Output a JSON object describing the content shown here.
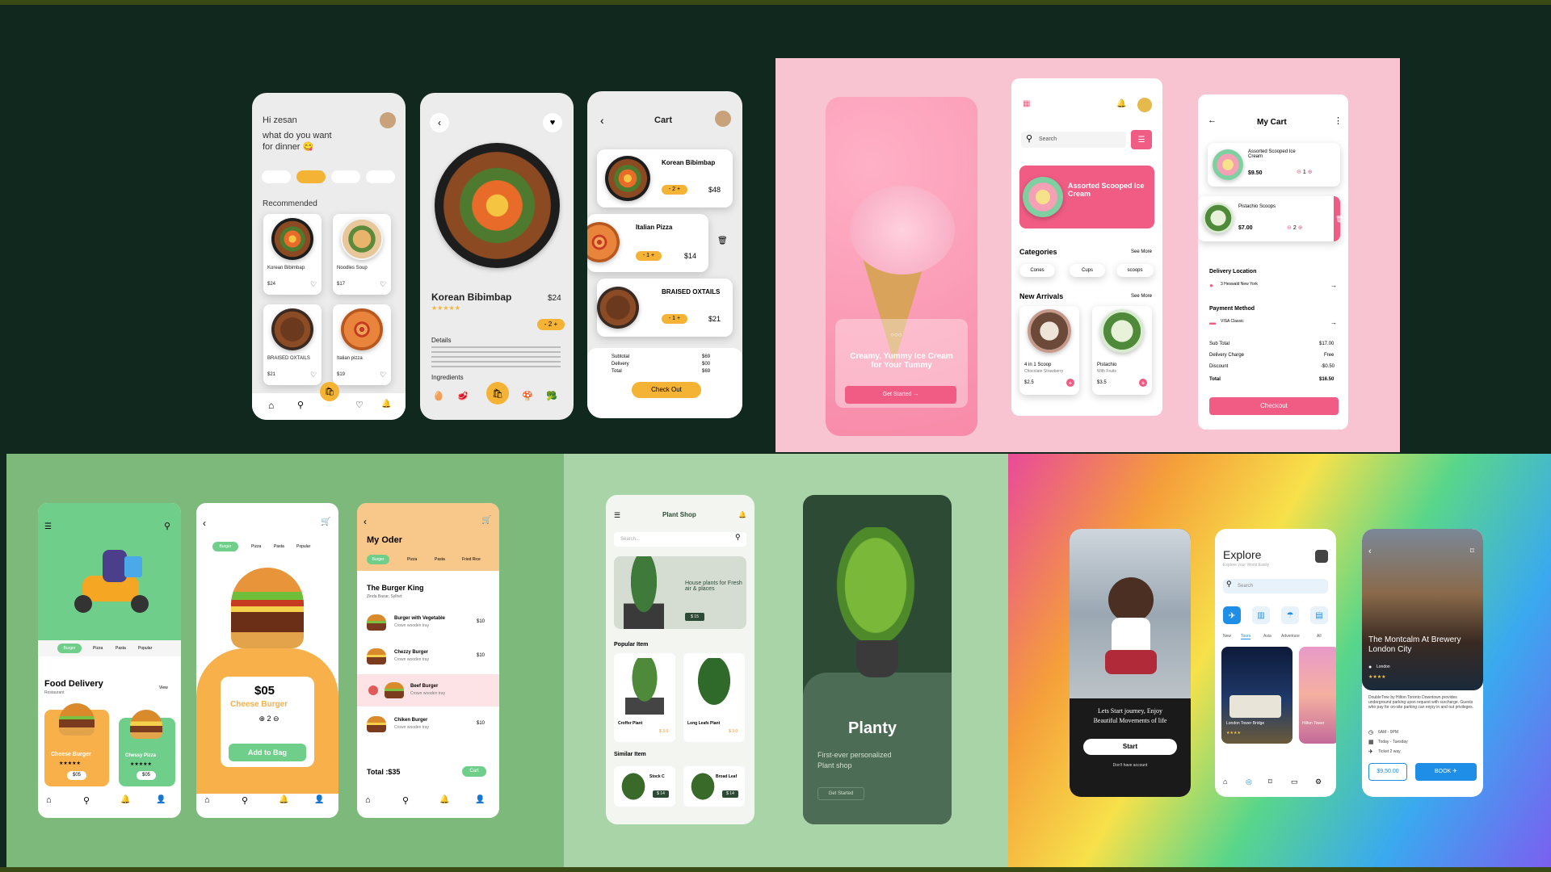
{
  "food_app": {
    "home": {
      "greeting": "Hi zesan",
      "question": "what do you want\nfor dinner 😋",
      "section": "Recommended",
      "items": [
        {
          "name": "Korean Bibimbap",
          "price": "$24"
        },
        {
          "name": "Noodles Soup",
          "price": "$17"
        },
        {
          "name": "BRAISED OXTAILS",
          "price": "$21"
        },
        {
          "name": "Italian pizza",
          "price": "$19"
        }
      ]
    },
    "detail": {
      "name": "Korean Bibimbap",
      "price": "$24",
      "qty": "2",
      "details_label": "Details",
      "ingredients_label": "Ingredients",
      "stars": "★★★★★"
    },
    "cart": {
      "title": "Cart",
      "items": [
        {
          "name": "Korean Bibimbap",
          "qty": "2",
          "price": "$48"
        },
        {
          "name": "Italian Pizza",
          "qty": "1",
          "price": "$14"
        },
        {
          "name": "BRAISED OXTAILS",
          "qty": "1",
          "price": "$21"
        }
      ],
      "subtotal_label": "Subtotal",
      "subtotal": "$69",
      "delivery_label": "Delivery",
      "delivery": "$00",
      "total_label": "Total",
      "total": "$69",
      "checkout": "Check Out"
    }
  },
  "icecream_app": {
    "splash": {
      "headline": "Creamy, Yummy Ice Cream for Your Tummy",
      "cta": "Get Started →"
    },
    "home": {
      "search_placeholder": "Search",
      "banner": "Assorted Scooped Ice Cream",
      "categories_label": "Categories",
      "see_more": "See More",
      "categories": [
        "Cones",
        "Cups",
        "scoops"
      ],
      "new_arrivals_label": "New Arrivals",
      "see_more2": "See More",
      "arrivals": [
        {
          "name": "4 in 1 Scoop",
          "sub": "Chocolate Strawberry",
          "price": "$2.5"
        },
        {
          "name": "Pistachio",
          "sub": "With Fruits",
          "price": "$3.5"
        }
      ]
    },
    "cart": {
      "title": "My Cart",
      "items": [
        {
          "name": "Assorted Scooped Ice Cream",
          "price": "$9.50",
          "qty": "1"
        },
        {
          "name": "Pistachio Scoops",
          "price": "$7.00",
          "qty": "2"
        }
      ],
      "delivery_label": "Delivery Location",
      "address": "3 Heswald New York",
      "payment_label": "Payment Method",
      "payment": "VISA Classic",
      "rows": [
        {
          "label": "Sub Total",
          "value": "$17.00"
        },
        {
          "label": "Delivery Charge",
          "value": "Free"
        },
        {
          "label": "Discount",
          "value": "-$0.50"
        },
        {
          "label": "Total",
          "value": "$16.50"
        }
      ],
      "checkout": "Checkout"
    }
  },
  "burger_app": {
    "home": {
      "title": "Food Delivery",
      "subtitle": "Restaurant",
      "view": "View",
      "tabs": [
        "Burger",
        "Pizza",
        "Pasta",
        "Popular"
      ],
      "cards": [
        {
          "name": "Cheese Burger",
          "price": "$05"
        },
        {
          "name": "Chessy Pizza",
          "price": "$05"
        }
      ]
    },
    "detail": {
      "tabs": [
        "Burger",
        "Pizza",
        "Pasta",
        "Popular"
      ],
      "price": "$05",
      "name": "Cheese Burger",
      "qty": "2",
      "cta": "Add to Bag"
    },
    "order": {
      "title": "My Oder",
      "tabs": [
        "Burger",
        "Pizza",
        "Pasta",
        "Fried Rice"
      ],
      "restaurant": "The Burger King",
      "address": "Zinda Bazar, Sylhet",
      "items": [
        {
          "name": "Burger with Vegetable",
          "sub": "Crown wooden tray",
          "price": "$10"
        },
        {
          "name": "Chezzy Burger",
          "sub": "Crown wooden tray",
          "price": "$10"
        },
        {
          "name": "Beef Burger",
          "sub": "Crown wooden tray",
          "price": ""
        },
        {
          "name": "Chiken Burger",
          "sub": "Crown wooden tray",
          "price": "$10"
        }
      ],
      "total": "Total :$35",
      "cart": "Cart"
    }
  },
  "plant_app": {
    "home": {
      "title": "Plant Shop",
      "search_placeholder": "Search...",
      "banner": "House plants for Fresh air & places",
      "banner_price": "$ 15",
      "popular": "Popular Item",
      "similar": "Similar Item",
      "popular_items": [
        {
          "name": "Croffer Plant",
          "price": "$ 3.0"
        },
        {
          "name": "Long Leafs Plant",
          "price": "$ 3.0"
        }
      ],
      "similar_items": [
        {
          "name": "Stock C",
          "price": "$ 14"
        },
        {
          "name": "Broad Leaf",
          "price": "$ 14"
        }
      ]
    },
    "splash": {
      "brand": "Planty",
      "tagline": "First-ever personalized\nPlant shop",
      "cta": "Get Started"
    }
  },
  "travel_app": {
    "splash": {
      "headline": "Lets Start journey, Enjoy\nBeautiful Movements of life",
      "cta": "Start",
      "sub": "Don't have account"
    },
    "explore": {
      "title": "Explore",
      "subtitle": "Explore your World Easily",
      "search_placeholder": "Search",
      "tabs": [
        "New",
        "Tours",
        "Asia",
        "Adventure",
        "All"
      ],
      "card1": "London Tower Bridge",
      "card2": "Hilton Tower"
    },
    "hotel": {
      "name": "The Montcalm At Brewery London City",
      "location": "London",
      "stars": "★★★★",
      "desc": "DoubleTree by Hilton Toronto Downtown provides underground parking upon request with surcharge. Guests who pay for on-site parking can enjoy in and out privileges.",
      "time": "6AM - 9PM",
      "days": "Today - Tuesday",
      "ticket": "Ticket 2 way",
      "price": "$9,50.00",
      "book": "BOOK"
    }
  },
  "colors": {
    "food_bg": "#11281f",
    "icecream_bg": "#f9c4d2",
    "burger_bg": "#7cb97a",
    "plant_bg": "#a8d4a8",
    "yellow": "#f5b335",
    "pink": "#f05c84",
    "green": "#34c26a",
    "orange": "#f8b04a",
    "plant_dark": "#2d4a35",
    "travel_blue": "#1e8ee6"
  }
}
